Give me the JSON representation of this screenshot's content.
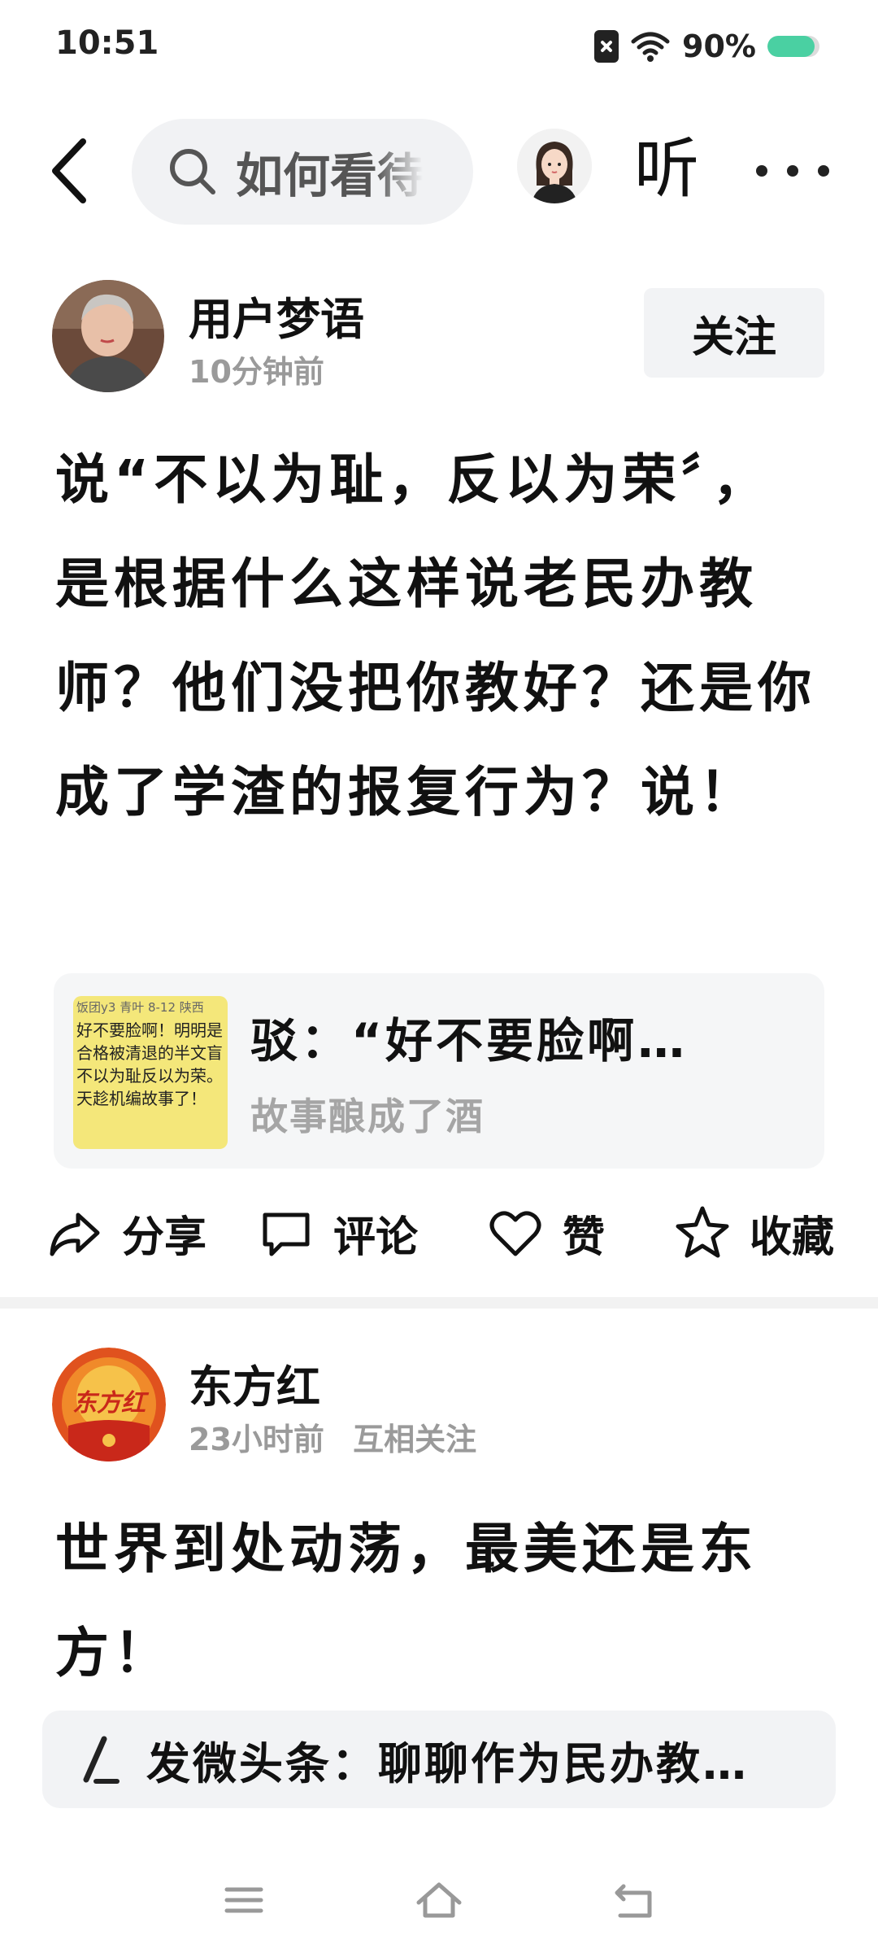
{
  "status_bar": {
    "time": "10:51",
    "battery": "90%",
    "battery_level": 0.9
  },
  "top_nav": {
    "search_text": "如何看待",
    "listen_label": "听"
  },
  "post1": {
    "user_name": "用户梦语",
    "time_ago": "10分钟前",
    "follow_label": "关注",
    "body": "说“不以为耻，反以为荣〞，是根据什么这样说老民办教师？他们没把你教好？还是你成了学渣的报复行为？说！",
    "quote": {
      "title": "驳：“好不要脸啊…",
      "source": "故事酿成了酒",
      "thumb_lines": [
        "饭团y3  青叶  8-12  陕西",
        "好不要脸啊！明明是",
        "合格被清退的半文盲",
        "不以为耻反以为荣。",
        "天趁机编故事了！"
      ]
    }
  },
  "actions": {
    "share": "分享",
    "comment": "评论",
    "like": "赞",
    "favorite": "收藏"
  },
  "post2": {
    "user_name": "东方红",
    "time_ago": "23小时前",
    "relation": "互相关注",
    "logo_text": "东方红",
    "body": "世界到处动荡，最美还是东方！"
  },
  "compose": {
    "text": "发微头条：聊聊作为民办教…"
  },
  "colors": {
    "accent_battery": "#4ad0a2",
    "muted_text": "#9a9a9a",
    "card_bg": "#f5f6f7"
  }
}
